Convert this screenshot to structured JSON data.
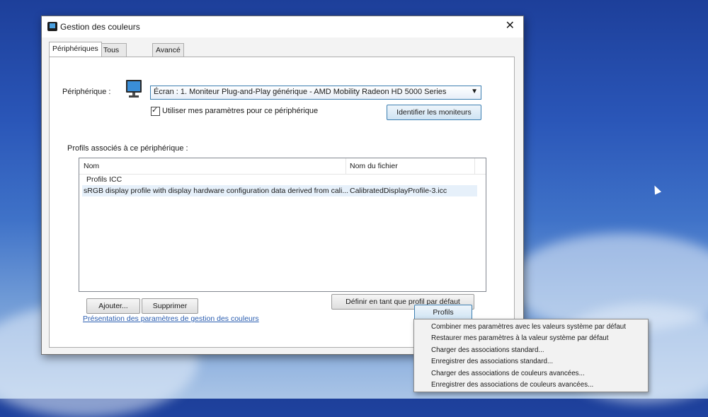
{
  "window": {
    "title": "Gestion des couleurs",
    "close_glyph": "✕"
  },
  "tabs": [
    {
      "label": "Périphériques"
    },
    {
      "label": "Tous les profils"
    },
    {
      "label": "Avancé"
    }
  ],
  "device": {
    "label": "Périphérique :",
    "selected": "Écran : 1. Moniteur Plug-and-Play générique - AMD Mobility Radeon HD 5000 Series",
    "checkbox_label": "Utiliser mes paramètres pour ce périphérique",
    "checkbox_checked": true,
    "identify_button": "Identifier les moniteurs"
  },
  "profiles": {
    "section_label": "Profils associés à ce périphérique :",
    "columns": [
      "Nom",
      "Nom du fichier"
    ],
    "group": "Profils ICC",
    "rows": [
      {
        "name": "sRGB display profile with display hardware configuration data derived from cali...",
        "file": "CalibratedDisplayProfile-3.icc"
      }
    ]
  },
  "buttons": {
    "add": "Ajouter...",
    "remove": "Supprimer",
    "set_default": "Définir en tant que profil par défaut",
    "profiles": "Profils"
  },
  "link": "Présentation des paramètres de gestion des couleurs",
  "profiles_menu": [
    "Combiner mes paramètres avec les valeurs système par défaut",
    "Restaurer mes paramètres à la valeur système par défaut",
    "Charger des associations standard...",
    "Enregistrer des associations standard...",
    "Charger des associations de couleurs avancées...",
    "Enregistrer des associations de couleurs avancées..."
  ],
  "icons": [
    "app-icon",
    "monitor-icon",
    "close-icon",
    "chevron-down-icon",
    "checkmark-icon",
    "mouse-cursor-icon"
  ]
}
